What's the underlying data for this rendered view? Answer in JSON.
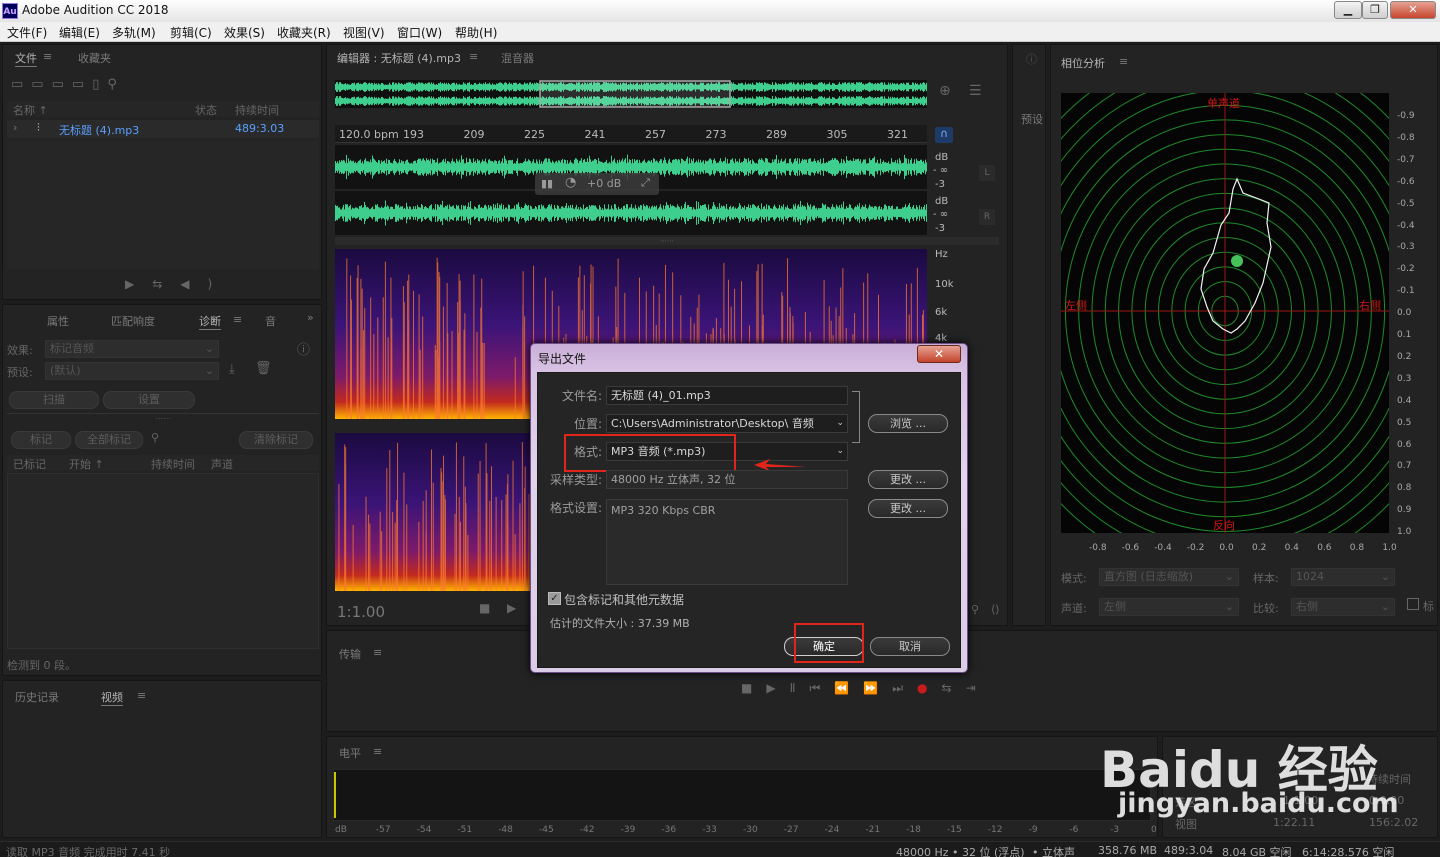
{
  "window": {
    "app_icon": "Au",
    "title": "Adobe Audition CC 2018",
    "controls": [
      "minimize-icon",
      "maximize-icon",
      "close-icon"
    ]
  },
  "menu": [
    "文件(F)",
    "编辑(E)",
    "多轨(M)",
    "剪辑(C)",
    "效果(S)",
    "收藏夹(R)",
    "视图(V)",
    "窗口(W)",
    "帮助(H)"
  ],
  "files_panel": {
    "tabs": [
      "文件",
      "收藏夹"
    ],
    "columns": [
      "名称 ↑",
      "状态",
      "持续时间"
    ],
    "rows": [
      {
        "name": "无标题 (4).mp3",
        "duration": "489:3.03"
      }
    ]
  },
  "diag_panel": {
    "tabs": [
      "属性",
      "匹配响度",
      "诊断",
      "音"
    ],
    "effect_label": "效果:",
    "effect_value": "标记音频",
    "preset_label": "预设:",
    "preset_value": "(默认)",
    "buttons": [
      "扫描",
      "设置"
    ],
    "mark_buttons": [
      "标记",
      "全部标记",
      "清除标记"
    ],
    "columns": [
      "已标记",
      "开始 ↑",
      "持续时间",
      "声道"
    ],
    "status": "检测到 0 段。"
  },
  "history_panel": {
    "tabs": [
      "历史记录",
      "视频"
    ]
  },
  "editor": {
    "tabs": [
      "编辑器 : 无标题 (4).mp3",
      "混音器"
    ],
    "bpm": "120.0 bpm",
    "timeline_ticks": [
      "193",
      "209",
      "225",
      "241",
      "257",
      "273",
      "289",
      "305",
      "321"
    ],
    "db_label": "dB",
    "db_inf": "- ∞",
    "db_minus3": "-3",
    "channel_left": "L",
    "channel_right": "R",
    "hud_gain": "+0 dB",
    "hz_label": "Hz",
    "hz_10k": "10k",
    "hz_6k": "6k",
    "hz_4k": "4k",
    "time": "1:1.00"
  },
  "presets_panel": {
    "label": "预设"
  },
  "phase_panel": {
    "title": "相位分析",
    "label_top": "单声道",
    "label_left": "左侧",
    "label_right": "右侧",
    "label_bottom": "反向",
    "y_ticks": [
      "-0.9",
      "-0.8",
      "-0.7",
      "-0.6",
      "-0.5",
      "-0.4",
      "-0.3",
      "-0.2",
      "-0.1",
      "0.0",
      "0.1",
      "0.2",
      "0.3",
      "0.4",
      "0.5",
      "0.6",
      "0.7",
      "0.8",
      "0.9",
      "1.0"
    ],
    "x_ticks": [
      "-0.8",
      "-0.6",
      "-0.4",
      "-0.2",
      "0.0",
      "0.2",
      "0.4",
      "0.6",
      "0.8",
      "1.0"
    ],
    "mode_label": "模式:",
    "mode_value": "直方图 (日志缩放)",
    "sample_label": "样本:",
    "sample_value": "1024",
    "channel_label": "声道:",
    "channel_value": "左侧",
    "compare_label": "比较:",
    "compare_value": "右侧",
    "check_label": "标"
  },
  "transport": {
    "title": "传输"
  },
  "levels": {
    "title": "电平",
    "ticks": [
      "dB",
      "-57",
      "-54",
      "-51",
      "-48",
      "-45",
      "-42",
      "-39",
      "-36",
      "-33",
      "-30",
      "-27",
      "-24",
      "-21",
      "-18",
      "-15",
      "-12",
      "-9",
      "-6",
      "-3",
      "0"
    ]
  },
  "selection_panel": {
    "header": "持续时间",
    "rows": [
      [
        "选区",
        "1:1.00",
        "0:0.00"
      ],
      [
        "视图",
        "1:22.11",
        "156:2.02"
      ]
    ]
  },
  "watermark": {
    "brand": "Baidu 经验",
    "url": "jingyan.baidu.com"
  },
  "status_bar": {
    "left": "读取 MP3 音频 完成用时 7.41 秒",
    "items": [
      "48000 Hz • 32 位 (浮点)",
      "• 立体声",
      "358.76 MB",
      "489:3.04",
      "8.04 GB 空闲",
      "6:14:28.576 空闲"
    ]
  },
  "dialog": {
    "title": "导出文件",
    "close": "✕",
    "filename_label": "文件名:",
    "filename": "无标题 (4)_01.mp3",
    "location_label": "位置:",
    "location": "C:\\Users\\Administrator\\Desktop\\ 音频",
    "browse": "浏览 ...",
    "format_label": "格式:",
    "format": "MP3 音频 (*.mp3)",
    "sample_type_label": "采样类型:",
    "sample_type": "48000 Hz 立体声, 32 位",
    "change1": "更改 ...",
    "format_settings_label": "格式设置:",
    "format_settings": "MP3 320 Kbps CBR",
    "change2": "更改 ...",
    "include_markers": "包含标记和其他元数据",
    "estimated_size": "估计的文件大小 : 37.39 MB",
    "ok": "确定",
    "cancel": "取消",
    "colors": {
      "highlight": "#e1251b",
      "wave": "#3ecf8e"
    }
  }
}
